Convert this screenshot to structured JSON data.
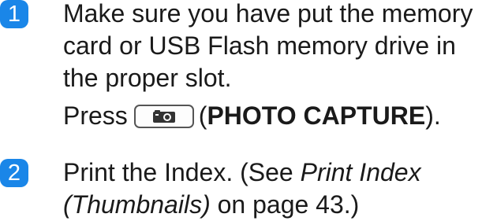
{
  "colors": {
    "badge_background": "#1a86e8",
    "badge_text": "#ffffff",
    "body_text": "#1a1a1a",
    "key_border": "#555555"
  },
  "steps": [
    {
      "number": "1",
      "text": "Make sure you have put the memory card or USB Flash memory drive in the proper slot.",
      "press": {
        "prefix": "Press",
        "key_icon": "camera-icon",
        "open_paren": "(",
        "key_name": "PHOTO CAPTURE",
        "close_paren": ")."
      }
    },
    {
      "number": "2",
      "text_before": "Print the Index. (See ",
      "link_text": "Print Index (Thumbnails)",
      "text_after": " on page 43.)"
    }
  ]
}
